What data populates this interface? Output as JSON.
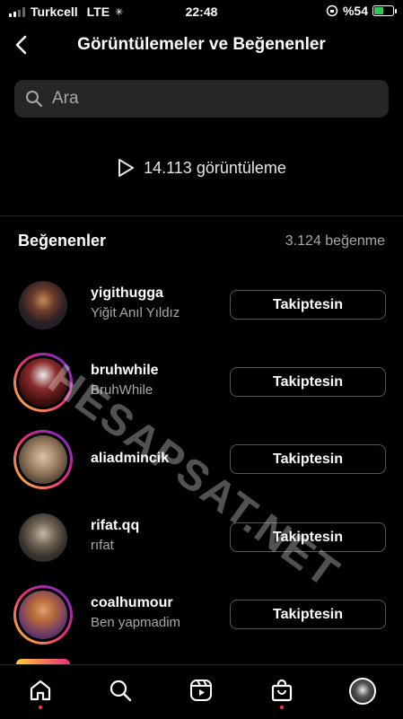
{
  "status": {
    "carrier": "Turkcell",
    "network": "LTE",
    "time": "22:48",
    "battery": "%54",
    "battery_level": 0.54
  },
  "header": {
    "title": "Görüntülemeler ve Beğenenler"
  },
  "search": {
    "placeholder": "Ara"
  },
  "views": {
    "text": "14.113 görüntüleme"
  },
  "likes": {
    "title": "Beğenenler",
    "count": "3.124 beğenme"
  },
  "watermark": "HESAPSAT.NET",
  "users": [
    {
      "username": "yigithugga",
      "fullname": "Yiğit Anıl Yıldız",
      "button": "Takiptesin"
    },
    {
      "username": "bruhwhile",
      "fullname": "BruhWhile",
      "button": "Takiptesin"
    },
    {
      "username": "aliadmincik",
      "fullname": "",
      "button": "Takiptesin"
    },
    {
      "username": "rifat.qq",
      "fullname": "rıfat",
      "button": "Takiptesin"
    },
    {
      "username": "coalhumour",
      "fullname": "Ben yapmadim",
      "button": "Takiptesin"
    }
  ],
  "tabs": [
    "home-icon",
    "search-icon",
    "reels-icon",
    "shop-icon",
    "profile-avatar"
  ],
  "colors": {
    "accent": "#ff3040",
    "battery": "#34c759",
    "muted": "#a8a8a8",
    "field": "#262626"
  }
}
